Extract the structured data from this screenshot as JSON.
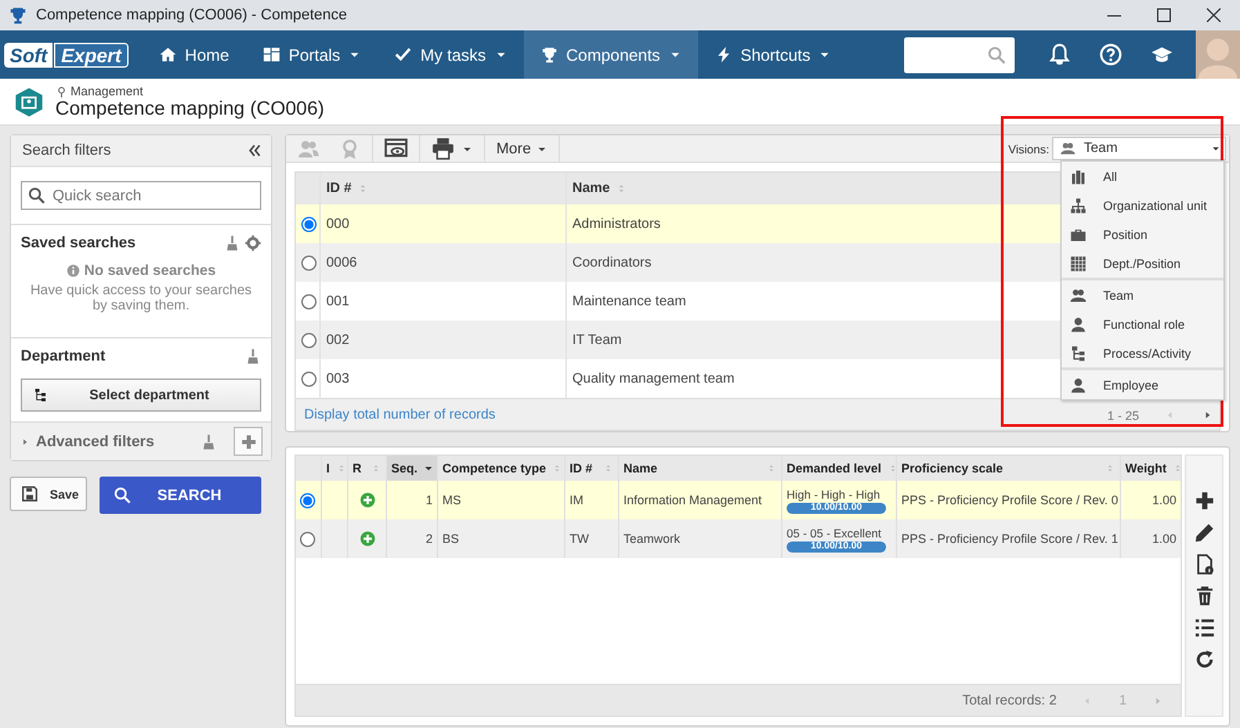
{
  "window": {
    "title": "Competence mapping (CO006) - Competence"
  },
  "nav": {
    "logo": {
      "first": "Soft",
      "second": "Expert"
    },
    "items": [
      {
        "label": "Home",
        "dropdown": false,
        "selected": false
      },
      {
        "label": "Portals",
        "dropdown": true,
        "selected": false
      },
      {
        "label": "My tasks",
        "dropdown": true,
        "selected": false
      },
      {
        "label": "Components",
        "dropdown": true,
        "selected": true
      },
      {
        "label": "Shortcuts",
        "dropdown": true,
        "selected": false
      }
    ]
  },
  "header": {
    "breadcrumb": "Management",
    "title": "Competence mapping (CO006)"
  },
  "filters": {
    "title": "Search filters",
    "quick_search": {
      "placeholder": "Quick search"
    },
    "saved_searches": {
      "title": "Saved searches",
      "empty_title": "No saved searches",
      "empty_text": "Have quick access to your searches by saving them."
    },
    "department": {
      "title": "Department",
      "button": "Select department"
    },
    "advanced": {
      "label": "Advanced filters",
      "expanded": false
    },
    "save": "Save",
    "search": "SEARCH"
  },
  "toolbar": {
    "more": "More",
    "visions_label": "Visions:",
    "visions_value": "Team"
  },
  "records": {
    "columns": [
      "ID #",
      "Name"
    ],
    "rows": [
      {
        "id": "000",
        "name": "Administrators",
        "selected": true
      },
      {
        "id": "0006",
        "name": "Coordinators",
        "selected": false
      },
      {
        "id": "001",
        "name": "Maintenance team",
        "selected": false
      },
      {
        "id": "002",
        "name": "IT Team",
        "selected": false
      },
      {
        "id": "003",
        "name": "Quality management team",
        "selected": false
      }
    ],
    "footer_link": "Display total number of records",
    "pager": "1 - 25"
  },
  "visions_menu": {
    "highlighted": true,
    "sections": [
      {
        "items": [
          {
            "label": "All"
          },
          {
            "label": "Organizational unit"
          },
          {
            "label": "Position"
          },
          {
            "label": "Dept./Position"
          }
        ]
      },
      {
        "items": [
          {
            "label": "Team"
          },
          {
            "label": "Functional role"
          },
          {
            "label": "Process/Activity"
          }
        ]
      },
      {
        "items": [
          {
            "label": "Employee"
          }
        ]
      }
    ]
  },
  "competences": {
    "columns": [
      {
        "label": "I",
        "sorted": false
      },
      {
        "label": "R",
        "sorted": false
      },
      {
        "label": "Seq.",
        "sorted": true
      },
      {
        "label": "Competence type",
        "sorted": false
      },
      {
        "label": "ID #",
        "sorted": false
      },
      {
        "label": "Name",
        "sorted": false
      },
      {
        "label": "Demanded level",
        "sorted": false
      },
      {
        "label": "Proficiency scale",
        "sorted": false
      },
      {
        "label": "Weight",
        "sorted": false
      }
    ],
    "rows": [
      {
        "selected": true,
        "seq": "1",
        "type": "MS",
        "id": "IM",
        "name": "Information Management",
        "demanded": "High - High - High",
        "level": 1,
        "level_text": "10.00/10.00",
        "scale": "PPS - Proficiency Profile Score / Rev. 0",
        "weight": "1.00"
      },
      {
        "selected": false,
        "seq": "2",
        "type": "BS",
        "id": "TW",
        "name": "Teamwork",
        "demanded": "05 - 05 - Excellent",
        "level": 1,
        "level_text": "10.00/10.00",
        "scale": "PPS - Proficiency Profile Score / Rev. 1",
        "weight": "1.00"
      }
    ],
    "total": "Total records: 2",
    "page": "1"
  }
}
